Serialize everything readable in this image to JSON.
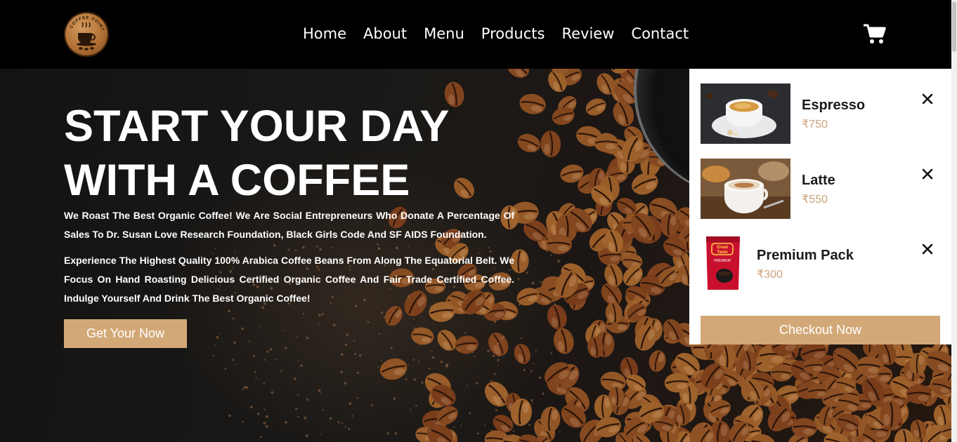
{
  "brand": {
    "logo_text": "COFFEE POINT"
  },
  "nav": {
    "items": [
      {
        "label": "Home"
      },
      {
        "label": "About"
      },
      {
        "label": "Menu"
      },
      {
        "label": "Products"
      },
      {
        "label": "Review"
      },
      {
        "label": "Contact"
      }
    ],
    "cart_icon": "shopping-cart-icon"
  },
  "hero": {
    "title_line1": "START YOUR DAY",
    "title_line2": "WITH A COFFEE",
    "paragraph1": "We Roast The Best Organic Coffee! We Are Social Entrepreneurs Who Donate A Percentage Of Sales To Dr. Susan Love Research Foundation, Black Girls Code And SF AIDS Foundation.",
    "paragraph2": "Experience The Highest Quality 100% Arabica Coffee Beans From Along The Equatorial Belt. We Focus On Hand Roasting Delicious Certified Organic Coffee And Fair Trade Certified Coffee. Indulge Yourself And Drink The Best Organic Coffee!",
    "cta_label": "Get Your Now"
  },
  "cart": {
    "items": [
      {
        "name": "Espresso",
        "price": "₹750",
        "remove_icon": "close-icon"
      },
      {
        "name": "Latte",
        "price": "₹550",
        "remove_icon": "close-icon"
      },
      {
        "name": "Premium Pack",
        "price": "₹300",
        "remove_icon": "close-icon",
        "package_text": "Great Taste",
        "package_sub": "PREMIUM"
      }
    ],
    "checkout_label": "Checkout Now"
  },
  "colors": {
    "accent": "#d3a877",
    "price": "#c9a27c",
    "header_bg": "#000000",
    "text_on_dark": "#ffffff"
  }
}
